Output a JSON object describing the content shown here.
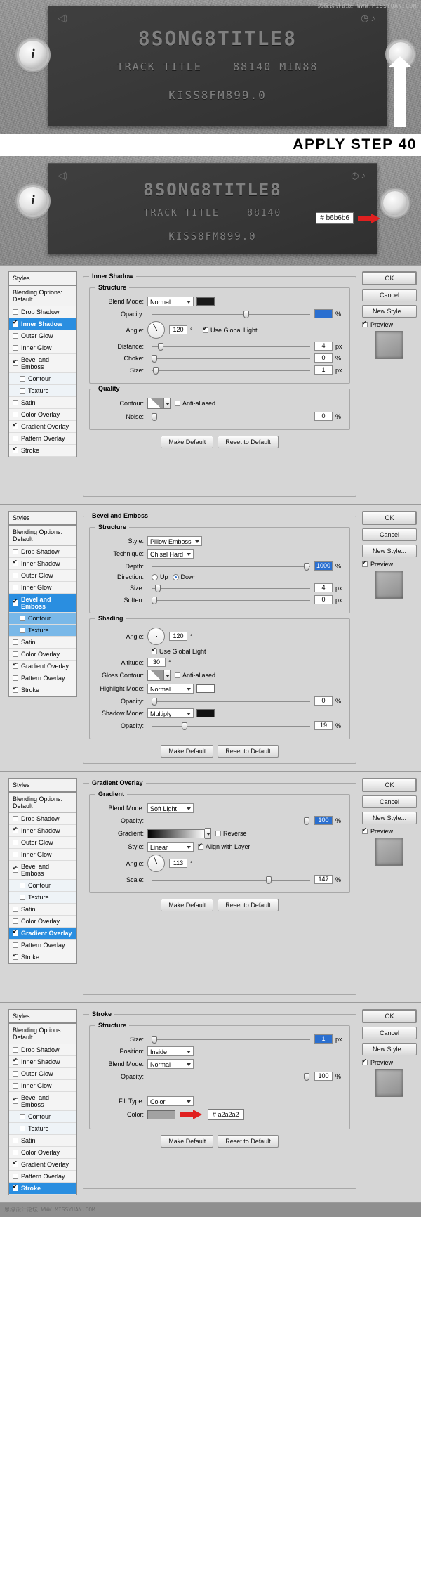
{
  "mockups": [
    {
      "name": "radio-step-before",
      "lcd": {
        "line1": "8SONG8TITLE8",
        "line2_left": "TRACK TITLE",
        "line2_right": "88140 MIN88",
        "line3": "KISS8FM899.0"
      },
      "icons": {
        "speaker": "◁)",
        "clock": "◷",
        "note": "♪"
      },
      "info_button": "i",
      "watermark": "思缘设计论坛  WWW.MISSYUAN.COM"
    },
    {
      "name": "radio-step-after",
      "lcd": {
        "line1": "8SONG8TITLE8",
        "line2_left": "TRACK TITLE",
        "line2_right": "88140",
        "line3": "KISS8FM899.0"
      },
      "icons": {
        "speaker": "◁)",
        "clock": "◷",
        "note": "♪"
      },
      "info_button": "i",
      "hex_callout": "#  b6b6b6"
    }
  ],
  "apply_caption": "APPLY STEP 40",
  "footer_watermark": "思缘设计论坛  WWW.MISSYUAN.COM",
  "common": {
    "styles_header": "Styles",
    "blending_options": "Blending Options: Default",
    "style_items": [
      {
        "label": "Drop Shadow",
        "checked": false
      },
      {
        "label": "Inner Shadow",
        "checked": true
      },
      {
        "label": "Outer Glow",
        "checked": false
      },
      {
        "label": "Inner Glow",
        "checked": false
      },
      {
        "label": "Bevel and Emboss",
        "checked": true
      },
      {
        "label": "Contour",
        "checked": false,
        "sub": true
      },
      {
        "label": "Texture",
        "checked": false,
        "sub": true
      },
      {
        "label": "Satin",
        "checked": false
      },
      {
        "label": "Color Overlay",
        "checked": false
      },
      {
        "label": "Gradient Overlay",
        "checked": true
      },
      {
        "label": "Pattern Overlay",
        "checked": false
      },
      {
        "label": "Stroke",
        "checked": true
      }
    ],
    "buttons": {
      "ok": "OK",
      "cancel": "Cancel",
      "new_style": "New Style...",
      "preview": "Preview",
      "make_default": "Make Default",
      "reset_to_default": "Reset to Default"
    },
    "labels": {
      "blend_mode": "Blend Mode:",
      "opacity": "Opacity:",
      "angle": "Angle:",
      "distance": "Distance:",
      "choke": "Choke:",
      "size": "Size:",
      "contour": "Contour:",
      "noise": "Noise:",
      "anti_aliased": "Anti-aliased",
      "use_global_light": "Use Global Light",
      "style": "Style:",
      "technique": "Technique:",
      "depth": "Depth:",
      "direction": "Direction:",
      "soften": "Soften:",
      "altitude": "Altitude:",
      "gloss_contour": "Gloss Contour:",
      "highlight_mode": "Highlight Mode:",
      "shadow_mode": "Shadow Mode:",
      "gradient": "Gradient:",
      "reverse": "Reverse",
      "align_with_layer": "Align with Layer",
      "scale": "Scale:",
      "position": "Position:",
      "fill_type": "Fill Type:",
      "color": "Color:",
      "up": "Up",
      "down": "Down"
    },
    "units": {
      "deg": "°",
      "px": "px",
      "pct": "%"
    },
    "sections": {
      "structure": "Structure",
      "quality": "Quality",
      "shading": "Shading",
      "gradient": "Gradient"
    }
  },
  "panels": [
    {
      "title": "Inner Shadow",
      "selected_style": "Inner Shadow",
      "fields": {
        "blend_mode": "Normal",
        "blend_color": "#1a1a1a",
        "opacity": "",
        "angle": "120",
        "use_global_light": true,
        "distance": "4",
        "choke": "0",
        "size": "1",
        "anti_aliased": false,
        "noise": "0"
      }
    },
    {
      "title": "Bevel and Emboss",
      "selected_style": "Bevel and Emboss",
      "fields": {
        "style": "Pillow Emboss",
        "technique": "Chisel Hard",
        "depth": "1000",
        "direction": "Down",
        "size": "4",
        "soften": "0",
        "angle": "120",
        "use_global_light": true,
        "altitude": "30",
        "anti_aliased": false,
        "highlight_mode": "Normal",
        "highlight_opacity": "0",
        "shadow_mode": "Multiply",
        "shadow_opacity": "19"
      }
    },
    {
      "title": "Gradient Overlay",
      "selected_style": "Gradient Overlay",
      "fields": {
        "blend_mode": "Soft Light",
        "opacity": "100",
        "reverse": false,
        "style": "Linear",
        "align_with_layer": true,
        "angle": "113",
        "scale": "147"
      }
    },
    {
      "title": "Stroke",
      "selected_style": "Stroke",
      "fields": {
        "size": "1",
        "position": "Inside",
        "blend_mode": "Normal",
        "opacity": "100",
        "fill_type": "Color",
        "color_hex": "#  a2a2a2",
        "color_swatch": "#a2a2a2"
      }
    }
  ]
}
